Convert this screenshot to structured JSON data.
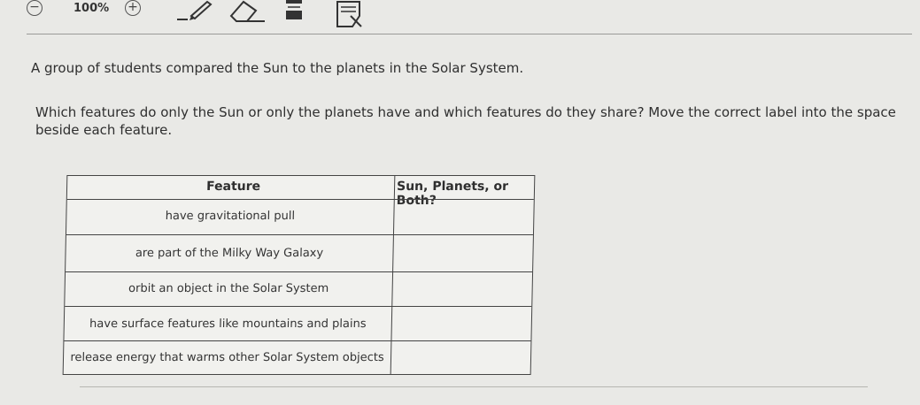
{
  "toolbar": {
    "zoom_out_icon": "−",
    "zoom_level": "100%",
    "zoom_in_icon": "+",
    "tools": [
      "pencil-icon",
      "eraser-icon",
      "highlighter-icon",
      "notepad-icon"
    ]
  },
  "intro_text": "A group of students compared the Sun to the planets in the Solar System.",
  "question_text": "Which features do only the Sun or only the planets have and which features do they share? Move the correct label into the space beside each feature.",
  "table": {
    "headers": [
      "Feature",
      "Sun, Planets, or Both?"
    ],
    "rows": [
      {
        "feature": "have gravitational pull",
        "answer": ""
      },
      {
        "feature": "are part of the Milky Way Galaxy",
        "answer": ""
      },
      {
        "feature": "orbit an object in the Solar System",
        "answer": ""
      },
      {
        "feature": "have surface features like mountains and plains",
        "answer": ""
      },
      {
        "feature": "release energy that warms other Solar System objects",
        "answer": ""
      }
    ]
  }
}
